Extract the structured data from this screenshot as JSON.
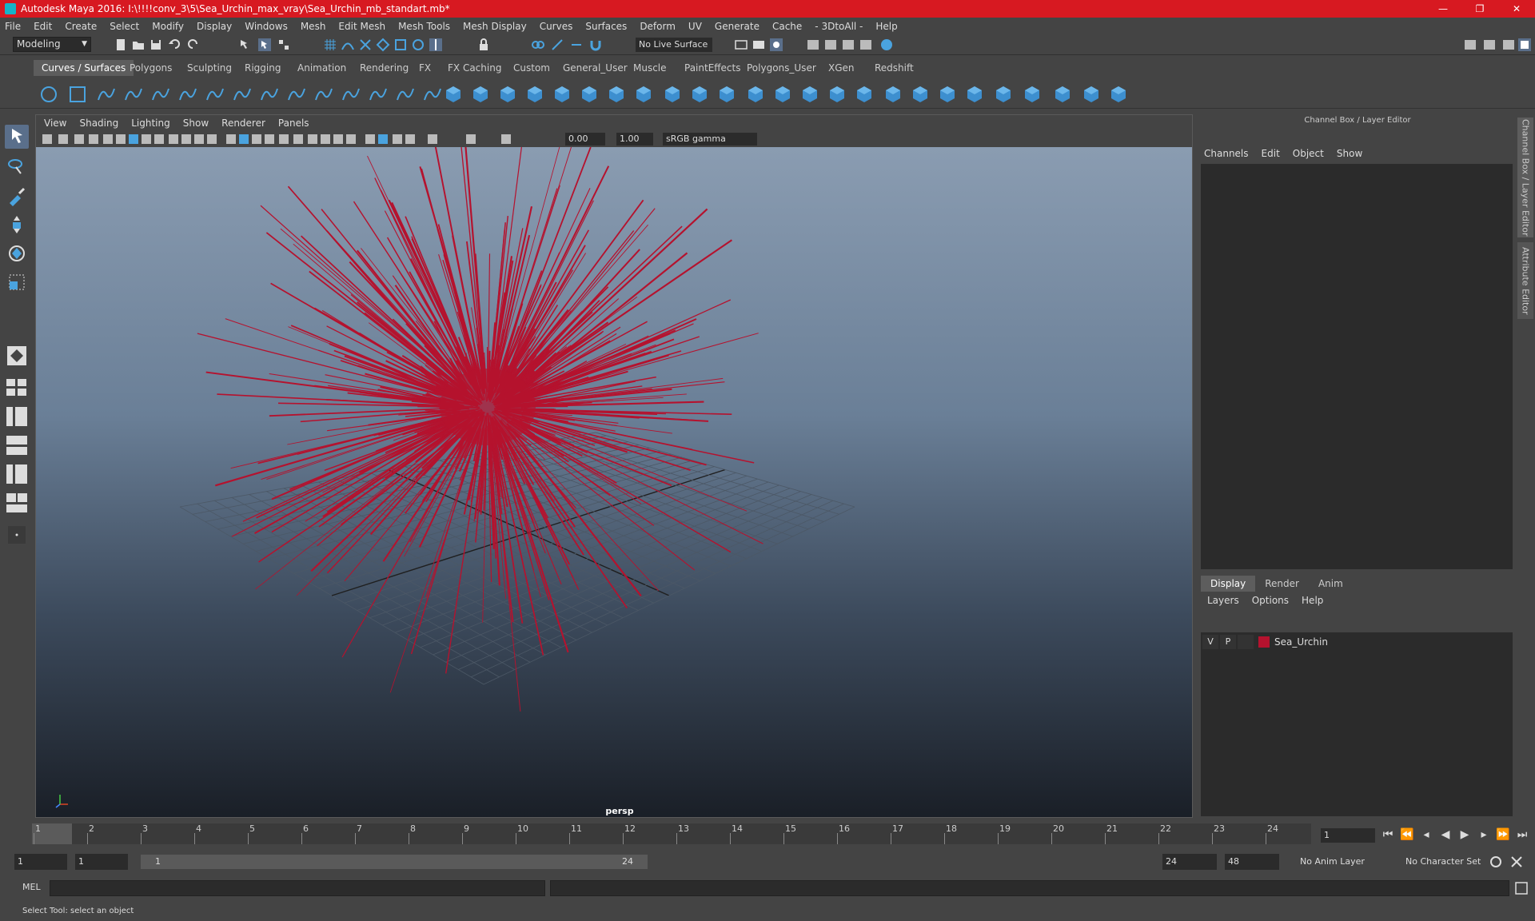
{
  "window": {
    "title": "Autodesk Maya 2016: I:\\!!!!conv_3\\5\\Sea_Urchin_max_vray\\Sea_Urchin_mb_standart.mb*",
    "minimize": "—",
    "restore": "❐",
    "close": "✕"
  },
  "menubar": [
    "File",
    "Edit",
    "Create",
    "Select",
    "Modify",
    "Display",
    "Windows",
    "Mesh",
    "Edit Mesh",
    "Mesh Tools",
    "Mesh Display",
    "Curves",
    "Surfaces",
    "Deform",
    "UV",
    "Generate",
    "Cache",
    "- 3DtoAll -",
    "Help"
  ],
  "statusline": {
    "mode": "Modeling",
    "live_surface": "No Live Surface"
  },
  "shelf_tabs": [
    "Curves / Surfaces",
    "Polygons",
    "Sculpting",
    "Rigging",
    "Animation",
    "Rendering",
    "FX",
    "FX Caching",
    "Custom",
    "General_User",
    "Muscle",
    "PaintEffects",
    "Polygons_User",
    "XGen",
    "Redshift"
  ],
  "shelf_active": "Curves / Surfaces",
  "viewport": {
    "menu": [
      "View",
      "Shading",
      "Lighting",
      "Show",
      "Renderer",
      "Panels"
    ],
    "exposure": "0.00",
    "gamma": "1.00",
    "color_space": "sRGB gamma",
    "camera": "persp",
    "object_color": "#b5122e"
  },
  "channel_box": {
    "title": "Channel Box / Layer Editor",
    "menu": [
      "Channels",
      "Edit",
      "Object",
      "Show"
    ],
    "side_tabs": [
      "Channel Box / Layer Editor",
      "Attribute Editor"
    ]
  },
  "layer_editor": {
    "tabs": [
      "Display",
      "Render",
      "Anim"
    ],
    "active_tab": "Display",
    "menu": [
      "Layers",
      "Options",
      "Help"
    ],
    "layers": [
      {
        "v": "V",
        "p": "P",
        "name": "Sea_Urchin",
        "color": "#b5122e"
      }
    ]
  },
  "timeline": {
    "ticks": [
      "1",
      "2",
      "3",
      "4",
      "5",
      "6",
      "7",
      "8",
      "9",
      "10",
      "11",
      "12",
      "13",
      "14",
      "15",
      "16",
      "17",
      "18",
      "19",
      "20",
      "21",
      "22",
      "23",
      "24"
    ],
    "current_frame": "1"
  },
  "range": {
    "start": "1",
    "playback_start": "1",
    "slider_start": "1",
    "slider_end": "24",
    "playback_end": "24",
    "end": "48",
    "anim_layer": "No Anim Layer",
    "character_set": "No Character Set"
  },
  "cmdline": {
    "label": "MEL"
  },
  "helpline": {
    "text": "Select Tool: select an object"
  }
}
